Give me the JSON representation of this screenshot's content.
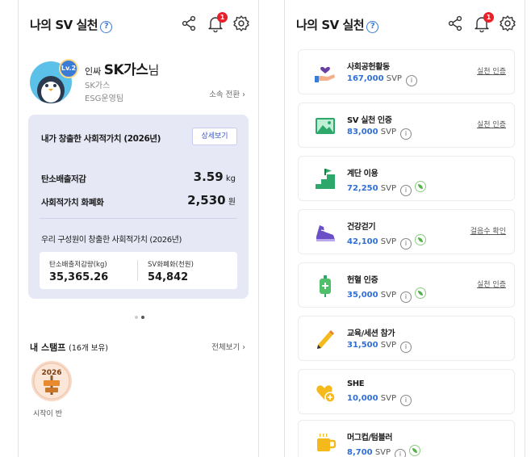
{
  "left": {
    "header": {
      "title": "나의 SV 실천",
      "help": "?",
      "notify_count": "1"
    },
    "profile": {
      "level": "Lv.2",
      "prefix": "인싸",
      "name": "SK가스",
      "suffix": "님",
      "company": "SK가스",
      "team": "ESG운영팀",
      "switch_label": "소속 전환 ›"
    },
    "card": {
      "title": "내가 창출한 사회적가치 (2026년)",
      "detail_label": "상세보기",
      "carbon_label": "탄소배출저감",
      "carbon_value": "3.59",
      "carbon_unit": "kg",
      "money_label": "사회적가치 화폐화",
      "money_value": "2,530",
      "money_unit": "원",
      "team_title": "우리 구성원이 창출한 사회적가치 (2026년)",
      "team_carbon_label": "탄소배출저감량(kg)",
      "team_carbon_value": "35,365.26",
      "team_money_label": "SV화폐화(천원)",
      "team_money_value": "54,842"
    },
    "stamps": {
      "title": "내 스탬프",
      "count": "(16개 보유)",
      "view_all": "전체보기 ›",
      "badge_year": "2026",
      "badge_label": "시작이 반"
    }
  },
  "right": {
    "header": {
      "title": "나의 SV 실천",
      "help": "?",
      "notify_count": "1"
    },
    "items": [
      {
        "name": "사회공헌활동",
        "points": "167,000",
        "unit": "SVP",
        "action": "실천 인증",
        "icon": "heart-hand-icon"
      },
      {
        "name": "SV 실천 인증",
        "points": "83,000",
        "unit": "SVP",
        "action": "실천 인증",
        "icon": "photo-icon"
      },
      {
        "name": "계단 이용",
        "points": "72,250",
        "unit": "SVP",
        "action": "",
        "icon": "stairs-icon"
      },
      {
        "name": "건강걷기",
        "points": "42,100",
        "unit": "SVP",
        "action": "걸음수 확인",
        "icon": "sneaker-icon"
      },
      {
        "name": "헌혈 인증",
        "points": "35,000",
        "unit": "SVP",
        "action": "실천 인증",
        "icon": "blood-bag-icon"
      },
      {
        "name": "교육/세션 참가",
        "points": "31,500",
        "unit": "SVP",
        "action": "",
        "icon": "pencil-icon"
      },
      {
        "name": "SHE",
        "points": "10,000",
        "unit": "SVP",
        "action": "",
        "icon": "heart-plus-icon"
      },
      {
        "name": "머그컵/텀블러",
        "points": "8,700",
        "unit": "SVP",
        "action": "",
        "icon": "mug-icon"
      }
    ]
  }
}
